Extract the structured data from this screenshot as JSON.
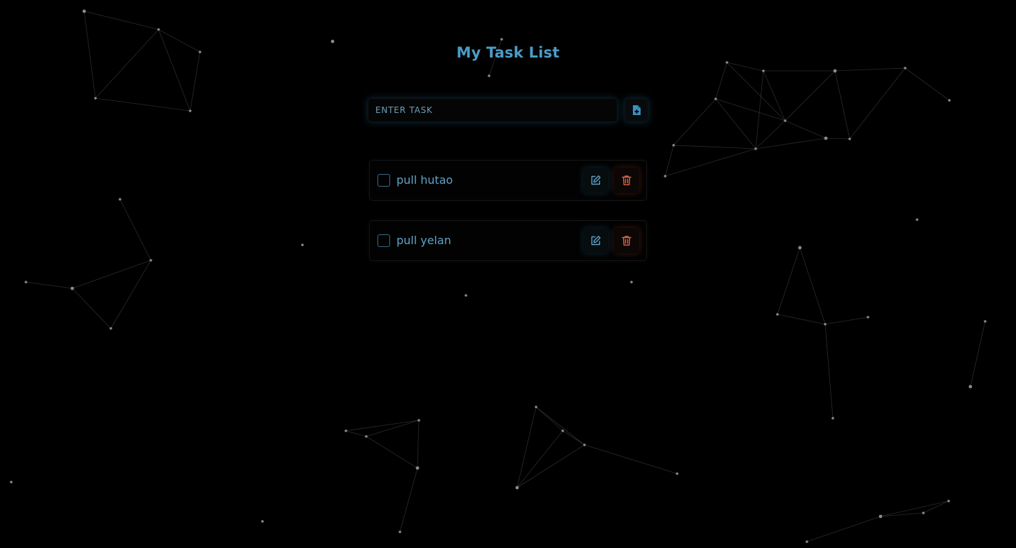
{
  "app": {
    "title": "My Task List"
  },
  "add_form": {
    "input_placeholder": "ENTER TASK",
    "input_value": "",
    "add_button_icon": "file-plus-icon"
  },
  "tasks": [
    {
      "text": "pull hutao",
      "completed": false,
      "edit_icon": "edit-icon",
      "delete_icon": "trash-icon"
    },
    {
      "text": "pull yelan",
      "completed": false,
      "edit_icon": "edit-icon",
      "delete_icon": "trash-icon"
    }
  ],
  "colors": {
    "background": "#000000",
    "accent": "#4a9cc7",
    "task_text": "#5fa3c7",
    "delete_accent": "#d8664a",
    "particle_dot": "#8a8a8a",
    "particle_line": "#3a3a3a"
  },
  "background": {
    "effect": "particle-network"
  }
}
